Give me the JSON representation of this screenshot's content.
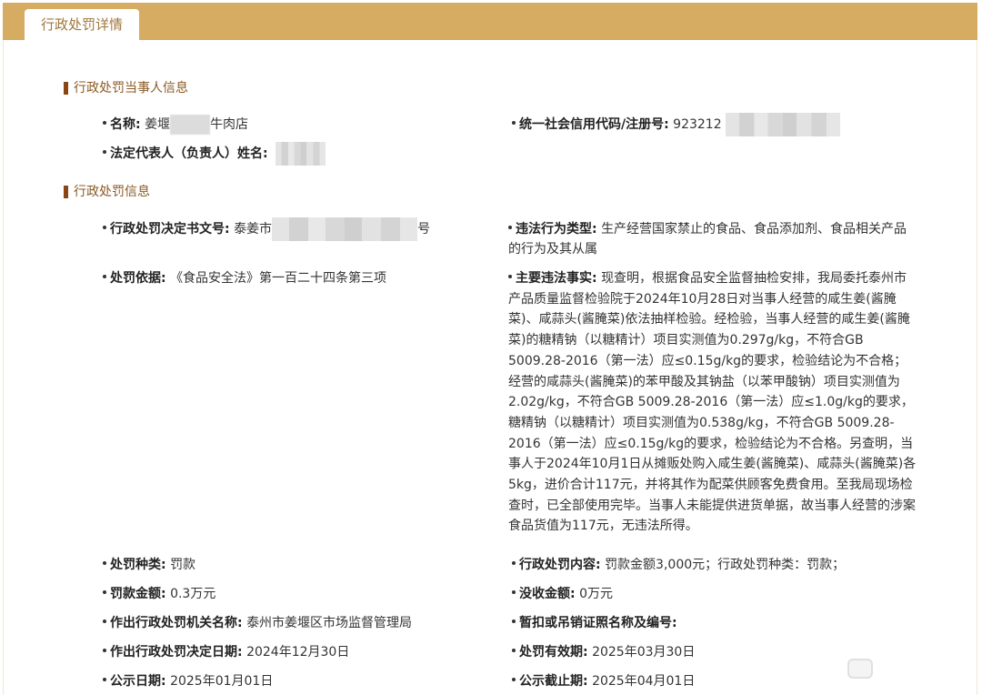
{
  "tab": {
    "label": "行政处罚详情"
  },
  "sections": {
    "party": "行政处罚当事人信息",
    "penalty": "行政处罚信息"
  },
  "party": {
    "name_label": "名称:",
    "name_prefix": "姜堰",
    "name_suffix": "牛肉店",
    "credit_code_label": "统一社会信用代码/注册号:",
    "credit_code_prefix": "923212",
    "legal_rep_label": "法定代表人（负责人）姓名:"
  },
  "penalty": {
    "decision_no_label": "行政处罚决定书文号:",
    "decision_no_prefix": "泰姜市",
    "decision_no_suffix": "号",
    "violation_type_label": "违法行为类型:",
    "violation_type_value": "生产经营国家禁止的食品、食品添加剂、食品相关产品的行为及其从属",
    "basis_label": "处罚依据:",
    "basis_value": "《食品安全法》第一百二十四条第三项",
    "facts_label": "主要违法事实:",
    "facts_value": "现查明，根据食品安全监督抽检安排，我局委托泰州市产品质量监督检验院于2024年10月28日对当事人经营的咸生姜(酱腌菜)、咸蒜头(酱腌菜)依法抽样检验。经检验，当事人经营的咸生姜(酱腌菜)的糖精钠（以糖精计）项目实测值为0.297g/kg，不符合GB 5009.28-2016（第一法）应≤0.15g/kg的要求，检验结论为不合格；经营的咸蒜头(酱腌菜)的苯甲酸及其钠盐（以苯甲酸钠）项目实测值为2.02g/kg，不符合GB 5009.28-2016（第一法）应≤1.0g/kg的要求，糖精钠（以糖精计）项目实测值为0.538g/kg，不符合GB 5009.28-2016（第一法）应≤0.15g/kg的要求，检验结论为不合格。另查明，当事人于2024年10月1日从摊贩处购入咸生姜(酱腌菜)、咸蒜头(酱腌菜)各5kg，进价合计117元，并将其作为配菜供顾客免费食用。至我局现场检查时，已全部使用完毕。当事人未能提供进货单据，故当事人经营的涉案食品货值为117元，无违法所得。",
    "type_label": "处罚种类:",
    "type_value": "罚款",
    "content_label": "行政处罚内容:",
    "content_value": "罚款金额3,000元；行政处罚种类：罚款；",
    "fine_label": "罚款金额:",
    "fine_value": "0.3万元",
    "confiscation_label": "没收金额:",
    "confiscation_value": "0万元",
    "authority_label": "作出行政处罚机关名称:",
    "authority_value": "泰州市姜堰区市场监督管理局",
    "license_label": "暂扣或吊销证照名称及编号:",
    "decision_date_label": "作出行政处罚决定日期:",
    "decision_date_value": "2024年12月30日",
    "validity_label": "处罚有效期:",
    "validity_value": "2025年03月30日",
    "publish_date_label": "公示日期:",
    "publish_date_value": "2025年01月01日",
    "publish_end_label": "公示截止期:",
    "publish_end_value": "2025年04月01日"
  },
  "colors": {
    "topbar": "#d6ac62",
    "tab_text": "#a0763d",
    "section_bar": "#8b4513",
    "section_text": "#8b5a24"
  },
  "icons": {
    "bullet": "bullet-dot-icon",
    "watermark": "watermark-logo-icon"
  }
}
